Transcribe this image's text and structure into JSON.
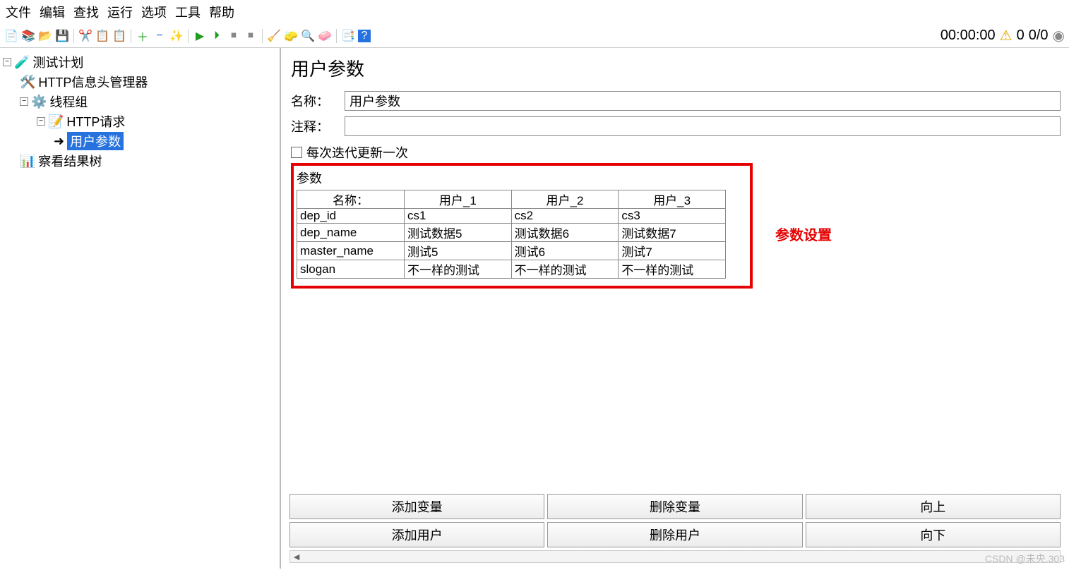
{
  "menu": [
    "文件",
    "编辑",
    "查找",
    "运行",
    "选项",
    "工具",
    "帮助"
  ],
  "status": {
    "time": "00:00:00",
    "warn_count": "0",
    "ratio": "0/0"
  },
  "tree": {
    "root": "测试计划",
    "http_header_mgr": "HTTP信息头管理器",
    "thread_group": "线程组",
    "http_request": "HTTP请求",
    "user_params": "用户参数",
    "view_results": "察看结果树"
  },
  "panel": {
    "title": "用户参数",
    "name_label": "名称：",
    "name_value": "用户参数",
    "comment_label": "注释：",
    "comment_value": "",
    "update_once": "每次迭代更新一次",
    "params_title": "参数",
    "annotation": "参数设置",
    "headers": [
      "名称：",
      "用户_1",
      "用户_2",
      "用户_3"
    ],
    "rows": [
      [
        "dep_id",
        "cs1",
        "cs2",
        "cs3"
      ],
      [
        "dep_name",
        "测试数据5",
        "测试数据6",
        "测试数据7"
      ],
      [
        "master_name",
        "测试5",
        "测试6",
        "测试7"
      ],
      [
        "slogan",
        "不一样的测试",
        "不一样的测试",
        "不一样的测试"
      ]
    ],
    "buttons": {
      "add_var": "添加变量",
      "del_var": "删除变量",
      "up": "向上",
      "add_user": "添加用户",
      "del_user": "删除用户",
      "down": "向下"
    }
  },
  "watermark": "CSDN @未央.303"
}
